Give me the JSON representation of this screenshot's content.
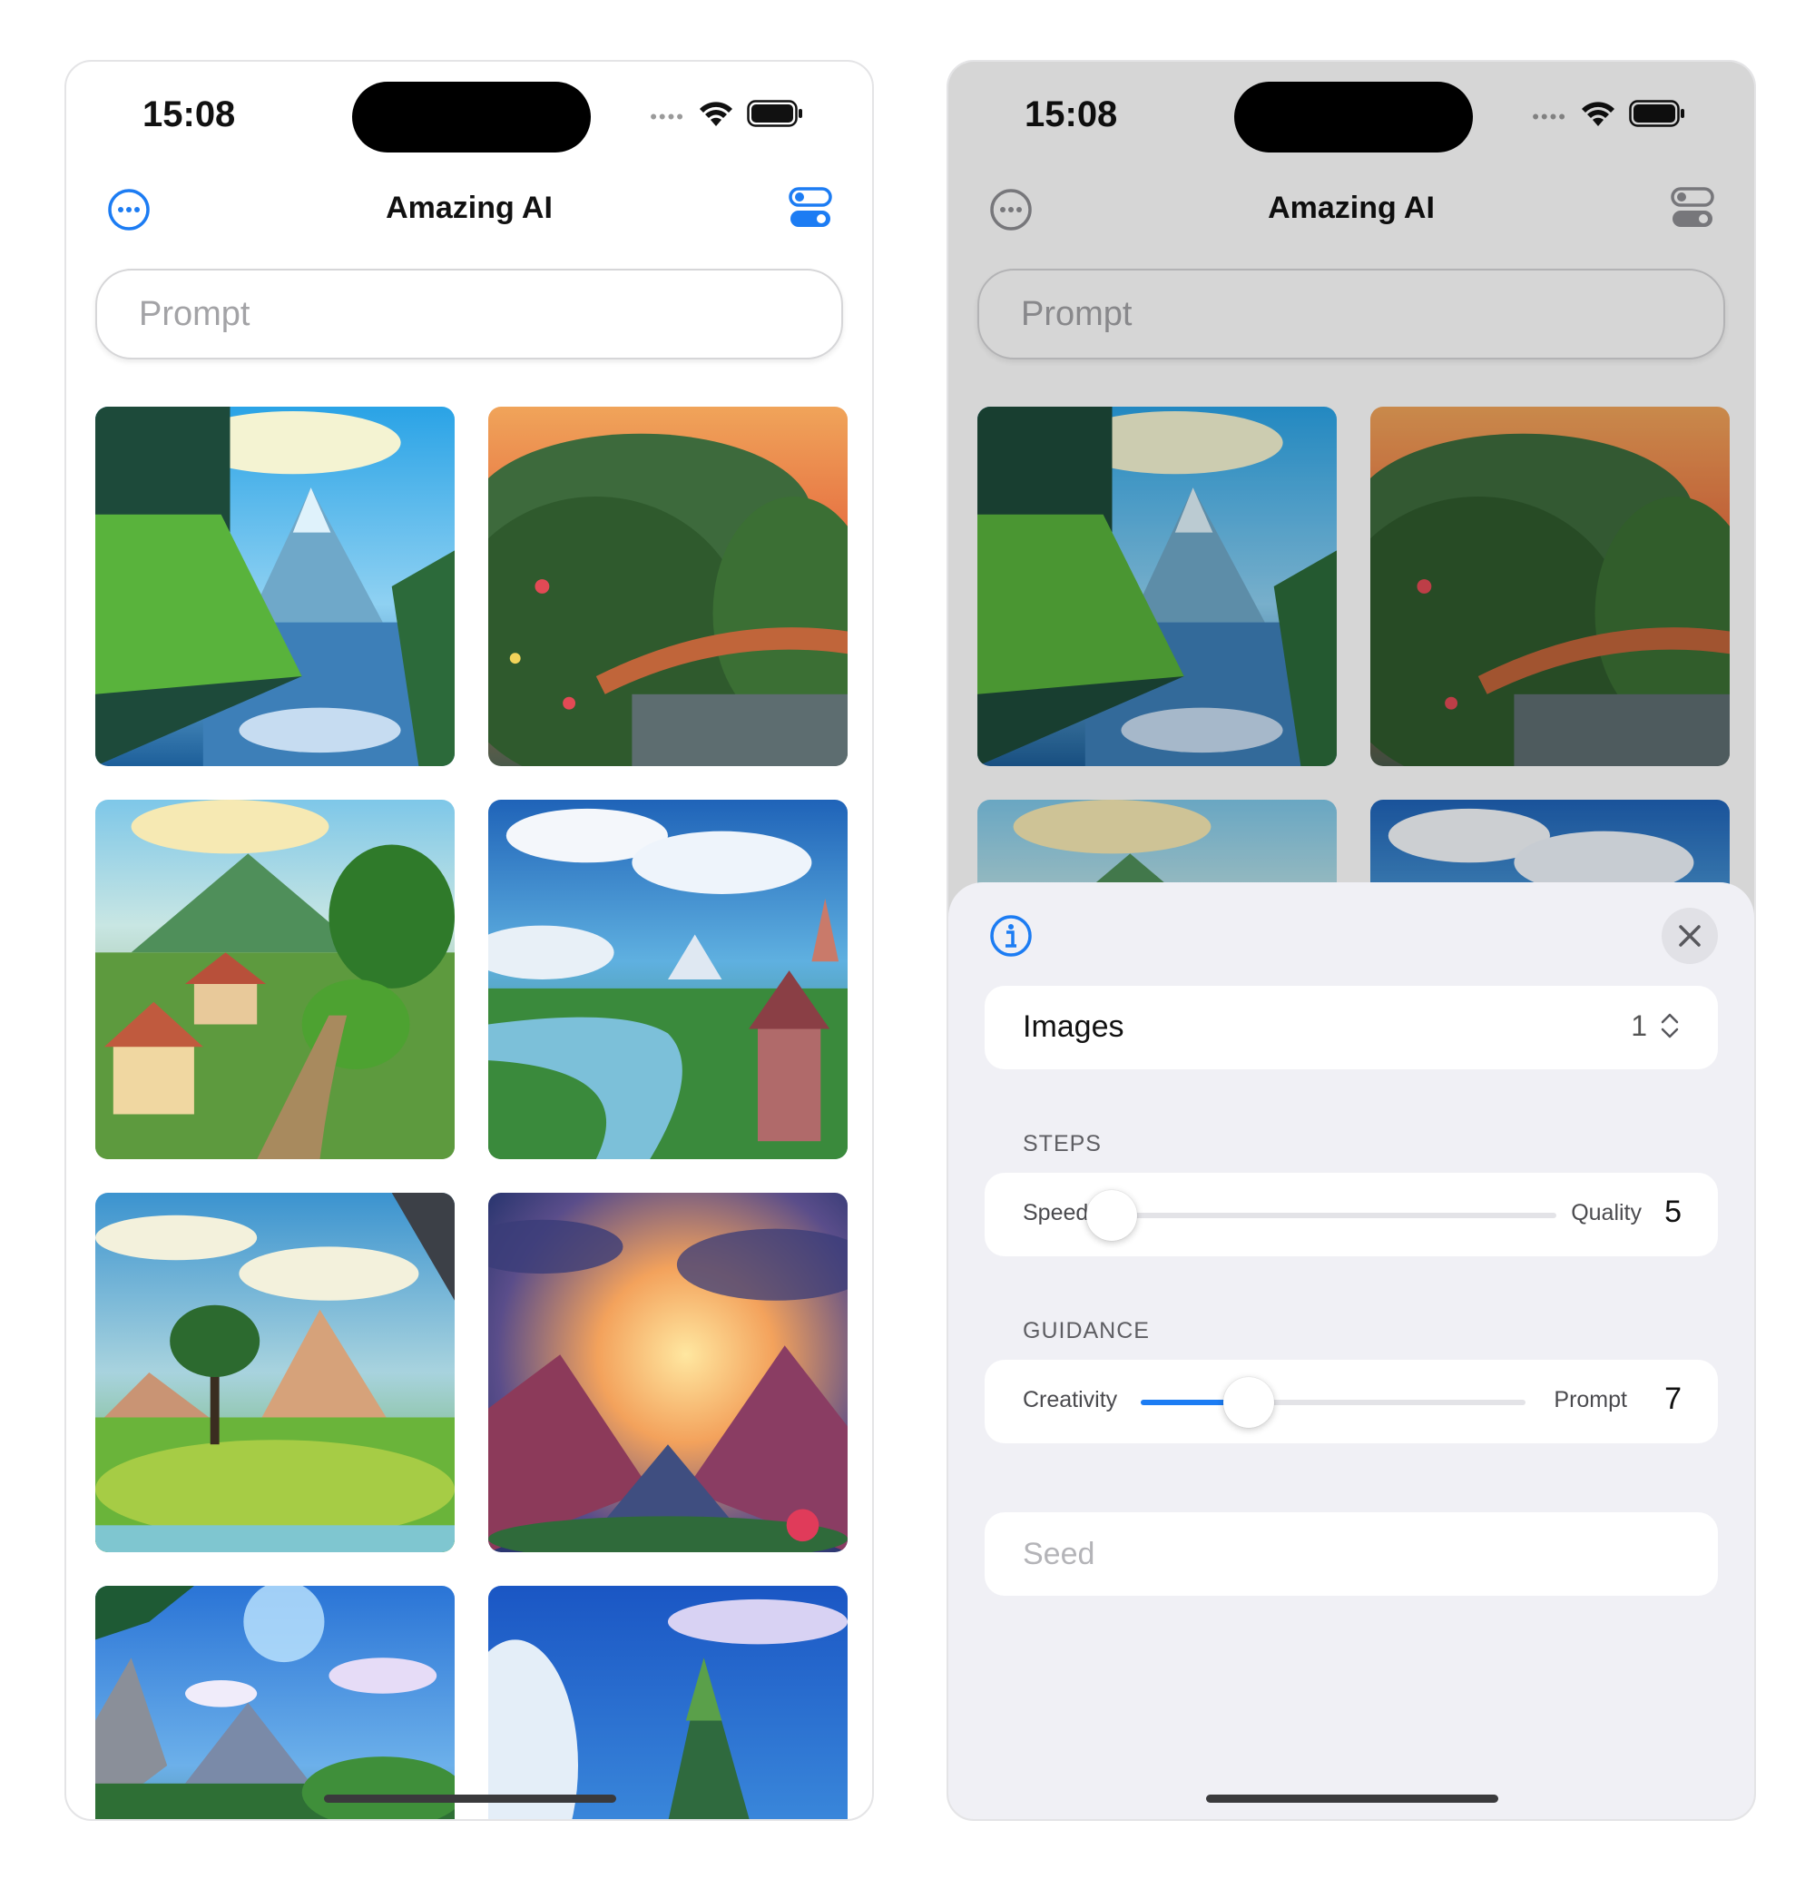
{
  "colors": {
    "accent": "#1c7cf3",
    "text": "#111111",
    "placeholder": "#a3a3a6",
    "sheet_bg": "#f0f0f5"
  },
  "left_screen": {
    "status_bar": {
      "time": "15:08",
      "icons": [
        "signal-dots-icon",
        "wifi-icon",
        "battery-icon"
      ]
    },
    "nav": {
      "title": "Amazing AI",
      "left_icon": "ellipsis-circle-icon",
      "right_icon": "toggles-icon"
    },
    "prompt": {
      "placeholder": "Prompt",
      "value": ""
    },
    "images": [
      {
        "name": "mountain-lake"
      },
      {
        "name": "bridge-sunset"
      },
      {
        "name": "village-valley"
      },
      {
        "name": "river-castle"
      },
      {
        "name": "tree-hills"
      },
      {
        "name": "sunset-mountains"
      },
      {
        "name": "blue-sky-cliffs"
      },
      {
        "name": "peak-clouds"
      }
    ]
  },
  "right_screen": {
    "status_bar": {
      "time": "15:08",
      "icons": [
        "signal-dots-icon",
        "wifi-icon",
        "battery-icon"
      ]
    },
    "nav": {
      "title": "Amazing AI",
      "left_icon": "ellipsis-circle-icon",
      "right_icon": "toggles-icon"
    },
    "prompt": {
      "placeholder": "Prompt",
      "value": ""
    },
    "settings_sheet": {
      "info_icon": "info-circle-icon",
      "close_icon": "xmark-icon",
      "images": {
        "label": "Images",
        "value": "1"
      },
      "steps": {
        "section": "STEPS",
        "left_label": "Speed",
        "right_label": "Quality",
        "value": "5",
        "level": 0.0
      },
      "guidance": {
        "section": "GUIDANCE",
        "left_label": "Creativity",
        "right_label": "Prompt",
        "value": "7",
        "level": 0.28
      },
      "seed": {
        "placeholder": "Seed",
        "value": ""
      }
    }
  }
}
